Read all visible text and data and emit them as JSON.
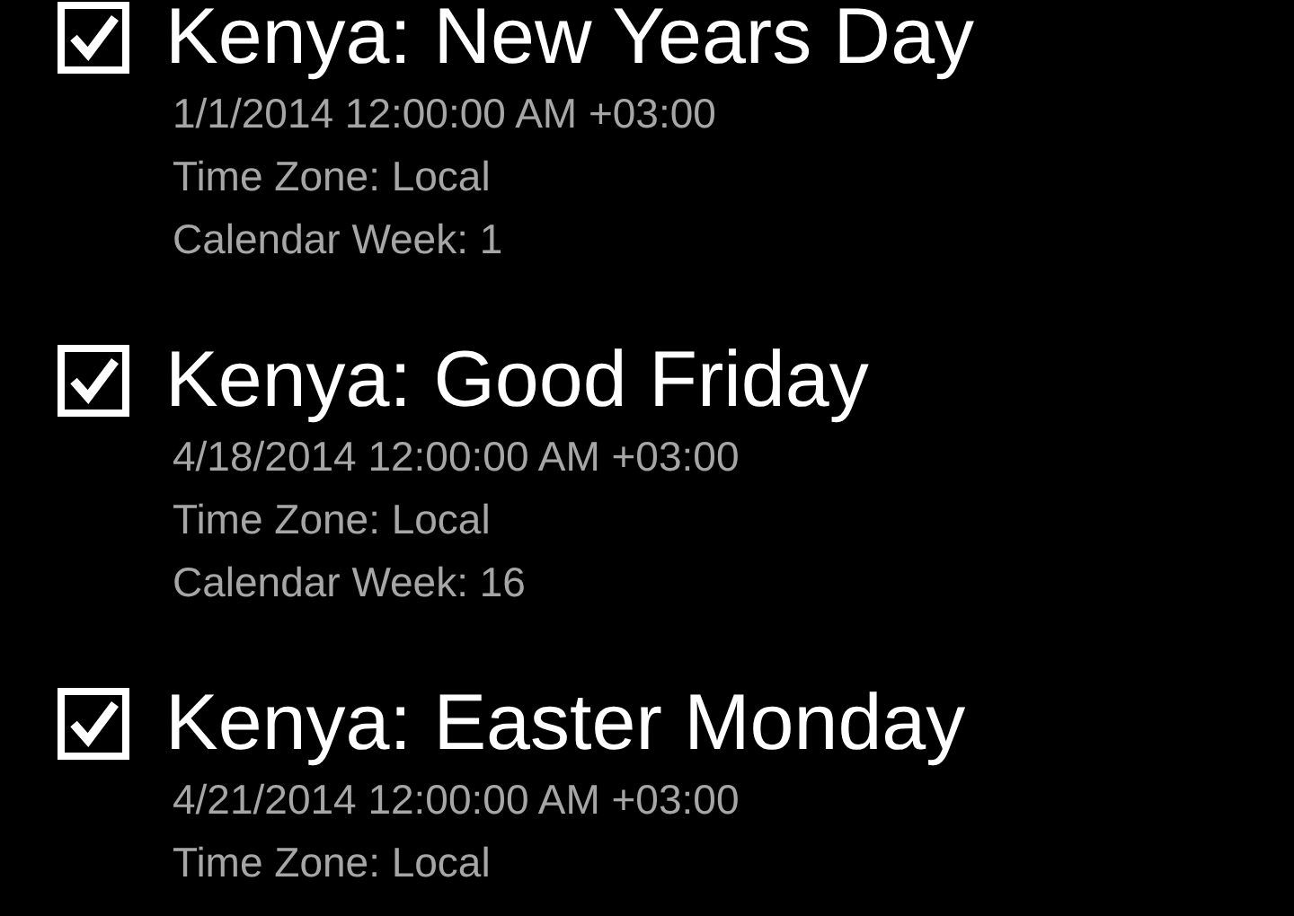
{
  "holidays": [
    {
      "title": "Kenya: New Years Day",
      "checked": true,
      "details": [
        "1/1/2014 12:00:00 AM +03:00",
        "Time Zone: Local",
        "Calendar Week: 1"
      ]
    },
    {
      "title": "Kenya: Good Friday",
      "checked": true,
      "details": [
        "4/18/2014 12:00:00 AM +03:00",
        "Time Zone: Local",
        "Calendar Week: 16"
      ]
    },
    {
      "title": "Kenya: Easter Monday",
      "checked": true,
      "details": [
        "4/21/2014 12:00:00 AM +03:00",
        "Time Zone: Local"
      ]
    }
  ]
}
